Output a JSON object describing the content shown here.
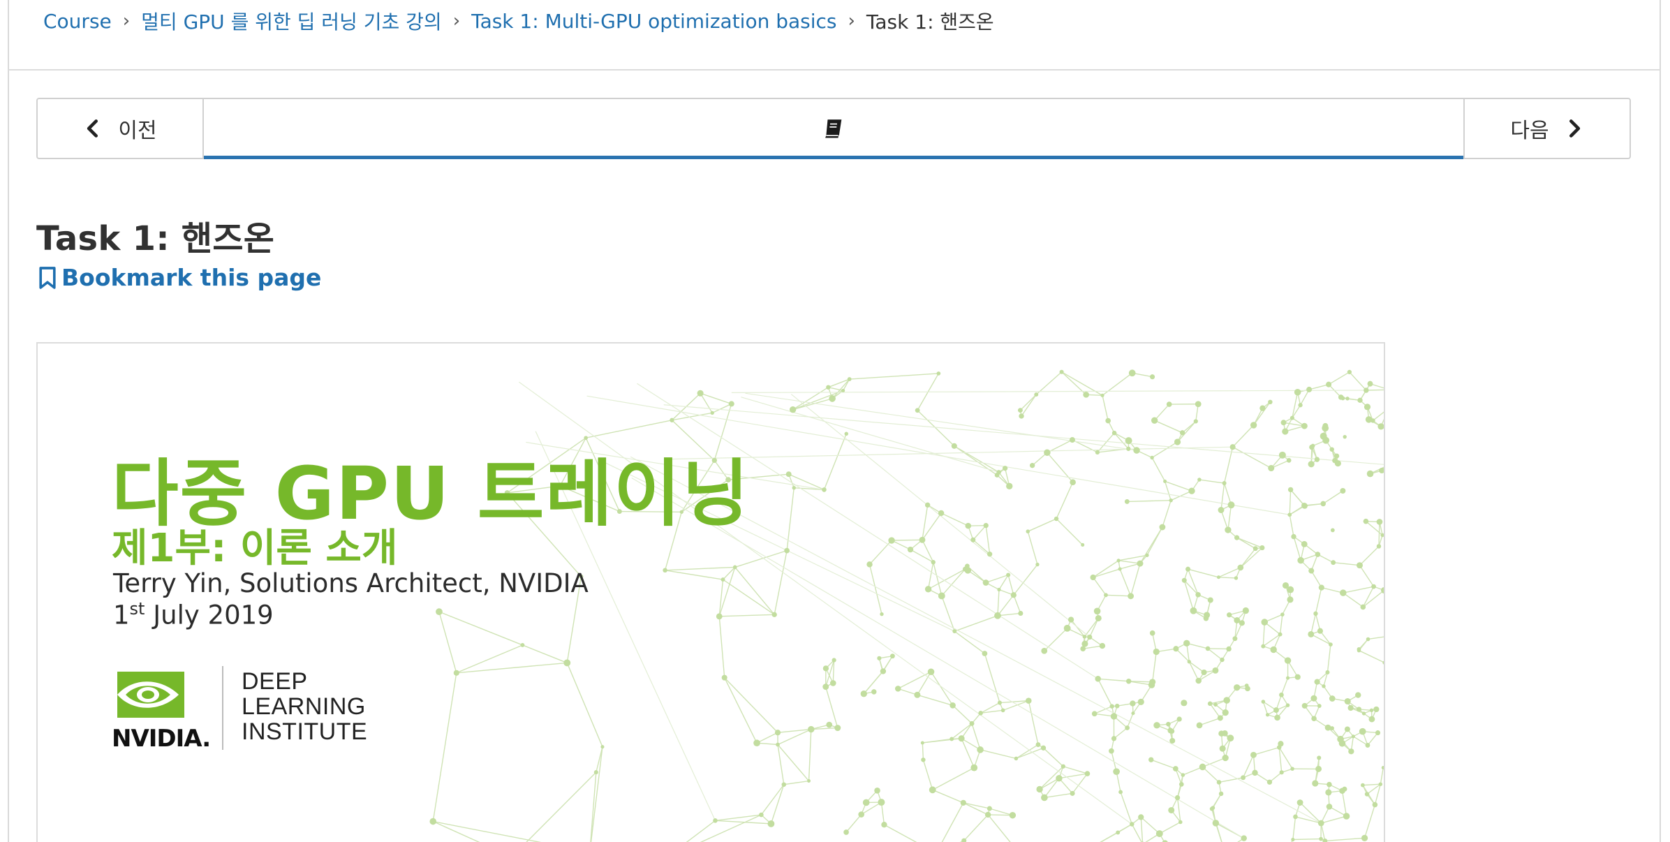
{
  "breadcrumb": {
    "items": [
      {
        "label": "Course"
      },
      {
        "label": "멀티 GPU 를 위한 딥 러닝 기초 강의"
      },
      {
        "label": "Task 1: Multi-GPU optimization basics"
      }
    ],
    "current": "Task 1: 핸즈온"
  },
  "sequence_nav": {
    "prev_label": "이전",
    "next_label": "다음",
    "active_tab_icon": "book-icon"
  },
  "unit": {
    "title": "Task 1: 핸즈온",
    "bookmark_label": "Bookmark this page"
  },
  "slide": {
    "title": "다중 GPU 트레이닝",
    "subtitle": "제1부: 이론 소개",
    "author": "Terry Yin, Solutions Architect, NVIDIA",
    "date_day": "1",
    "date_suffix": "st",
    "date_rest": " July 2019",
    "logo_word": "NVIDIA.",
    "institute_line1": "DEEP",
    "institute_line2": "LEARNING",
    "institute_line3": "INSTITUTE",
    "accent_color": "#76b82a"
  },
  "colors": {
    "link": "#1f6faf",
    "active_tab_underline": "#2a73b0"
  }
}
